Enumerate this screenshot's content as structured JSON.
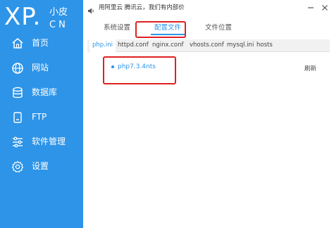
{
  "logo": {
    "brand": "XP.",
    "name": "小皮",
    "cn": "CN"
  },
  "sidebar": {
    "items": [
      {
        "label": "首页",
        "icon": "home-icon"
      },
      {
        "label": "网站",
        "icon": "globe-icon"
      },
      {
        "label": "数据库",
        "icon": "database-icon"
      },
      {
        "label": "FTP",
        "icon": "ftp-icon"
      },
      {
        "label": "软件管理",
        "icon": "sliders-icon"
      },
      {
        "label": "设置",
        "icon": "gear-icon"
      }
    ],
    "active_index": 5
  },
  "titlebar": {
    "notice": "用阿里云 腾讯云，我们有内部价"
  },
  "tabs": [
    {
      "label": "系统设置"
    },
    {
      "label": "配置文件"
    },
    {
      "label": "文件位置"
    }
  ],
  "subtabs": [
    {
      "label": "php.ini"
    },
    {
      "label": "httpd.conf"
    },
    {
      "label": "nginx.conf"
    },
    {
      "label": "vhosts.conf"
    },
    {
      "label": "mysql.ini"
    },
    {
      "label": "hosts"
    }
  ],
  "content": {
    "version_item": "php7.3.4nts",
    "refresh_label": "刷新"
  },
  "colors": {
    "accent": "#2d94e8",
    "highlight": "#e02020"
  }
}
